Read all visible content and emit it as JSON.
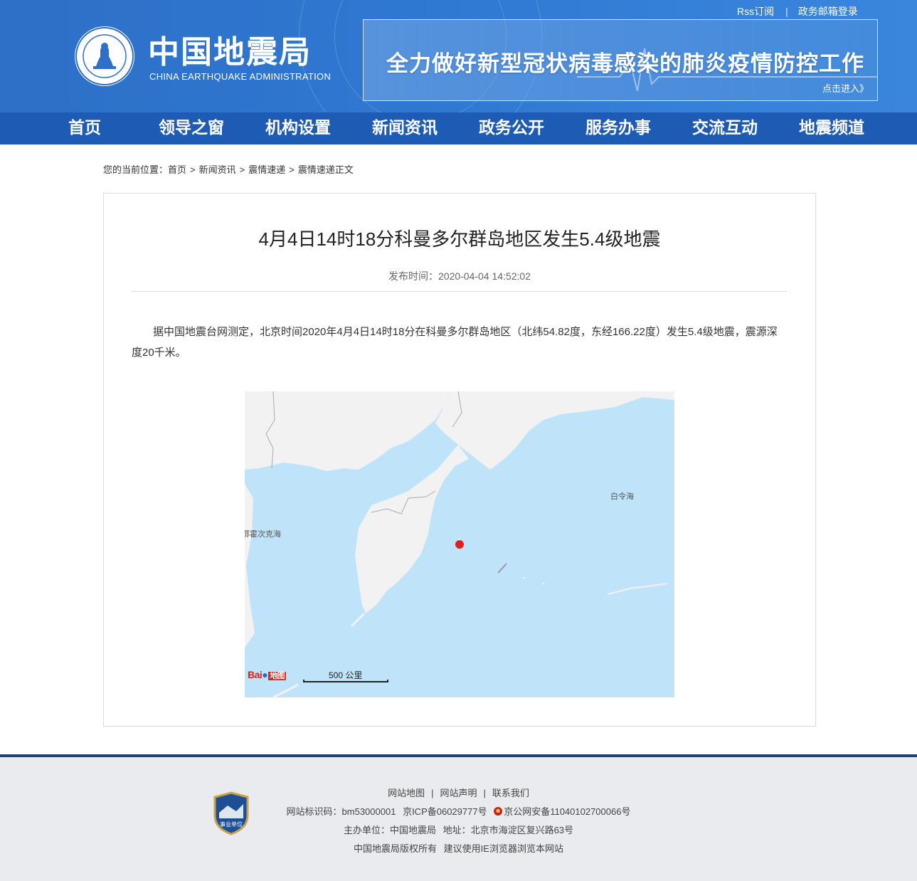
{
  "header": {
    "top_links": [
      "Rss订阅",
      "政务邮箱登录"
    ],
    "site_title": "中国地震局",
    "site_subtitle": "CHINA EARTHQUAKE ADMINISTRATION",
    "banner_text": "全力做好新型冠状病毒感染的肺炎疫情防控工作",
    "banner_more": "点击进入》"
  },
  "nav": {
    "items": [
      "首页",
      "领导之窗",
      "机构设置",
      "新闻资讯",
      "政务公开",
      "服务办事",
      "交流互动",
      "地震频道"
    ]
  },
  "breadcrumb": {
    "prefix": "您的当前位置：",
    "items": [
      "首页",
      "新闻资讯",
      "震情速递",
      "震情速递正文"
    ],
    "separator": ">"
  },
  "article": {
    "title": "4月4日14时18分科曼多尔群岛地区发生5.4级地震",
    "publish_time": "发布时间：2020-04-04 14:52:02",
    "body": "据中国地震台网测定，北京时间2020年4月4日14时18分在科曼多尔群岛地区（北纬54.82度，东经166.22度）发生5.4级地震，震源深度20千米。"
  },
  "map": {
    "labels": {
      "bering_sea": "白令海",
      "okhotsk_sea": "鄂霍次克海"
    },
    "scale_label": "500 公里",
    "provider": "Bai地图",
    "epicenter_color": "#e02020",
    "ocean_color": "#bfe3f8",
    "land_color": "#f2f2f2"
  },
  "footer": {
    "links": [
      "网站地图",
      "网站声明",
      "联系我们"
    ],
    "site_id": "网站标识码：bm53000001",
    "icp": "京ICP备06029777号",
    "police_record": "京公网安备11040102700066号",
    "sponsor": "主办单位：中国地震局",
    "address": "地址：北京市海淀区复兴路63号",
    "copyright": "中国地震局版权所有",
    "browser_tip": "建议使用IE浏览器浏览本网站",
    "badge_text": "事业单位"
  }
}
